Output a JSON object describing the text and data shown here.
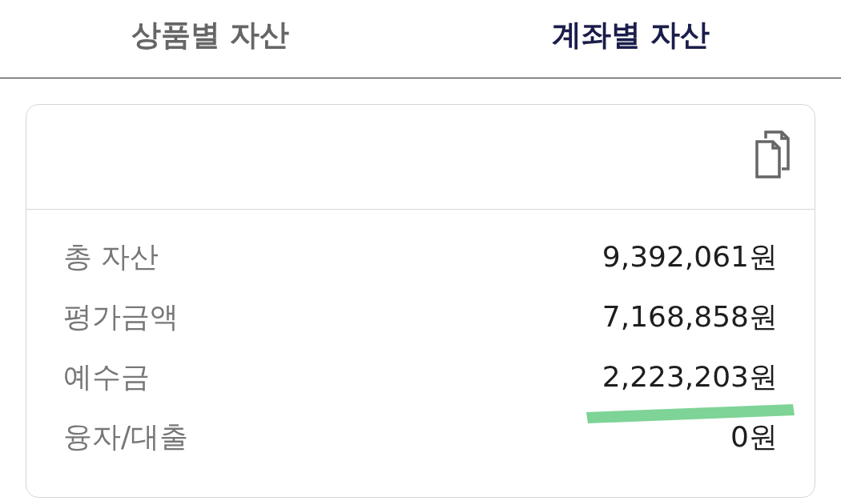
{
  "tabs": [
    {
      "label": "상품별 자산",
      "selected": false
    },
    {
      "label": "계좌별 자산",
      "selected": true
    }
  ],
  "account_card": {
    "rows": [
      {
        "label": "총 자산",
        "value": "9,392,061원",
        "highlighted": false
      },
      {
        "label": "평가금액",
        "value": "7,168,858원",
        "highlighted": false
      },
      {
        "label": "예수금",
        "value": "2,223,203원",
        "highlighted": true
      },
      {
        "label": "융자/대출",
        "value": "0원",
        "highlighted": false
      }
    ]
  }
}
